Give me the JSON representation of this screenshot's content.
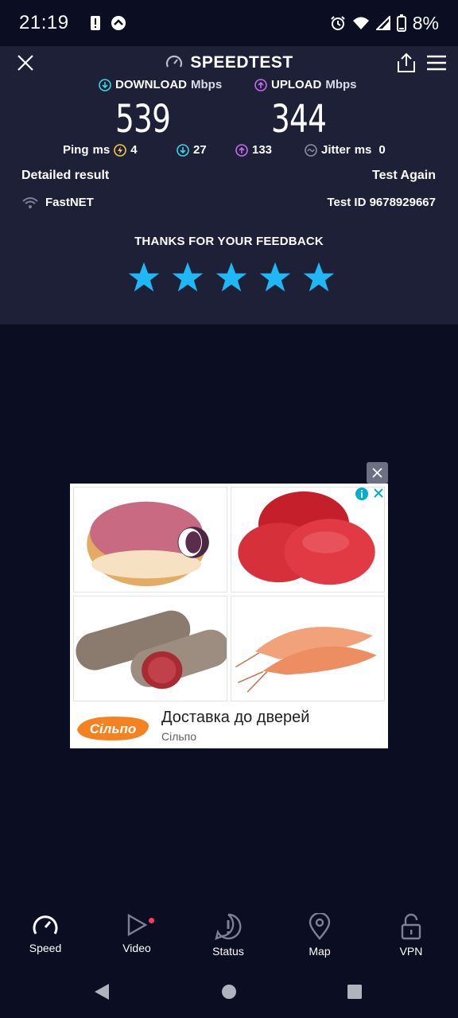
{
  "status_bar": {
    "time": "21:19",
    "battery": "8%"
  },
  "header": {
    "title": "SPEEDTEST"
  },
  "results": {
    "download_label": "DOWNLOAD",
    "upload_label": "UPLOAD",
    "unit": "Mbps",
    "download_value": "539",
    "upload_value": "344"
  },
  "latency": {
    "ping_label": "Ping",
    "ping_unit": "ms",
    "ping_value": "4",
    "ping_download": "27",
    "ping_upload": "133",
    "jitter_label": "Jitter",
    "jitter_unit": "ms",
    "jitter_value": "0"
  },
  "actions": {
    "detailed_result": "Detailed result",
    "test_again": "Test Again"
  },
  "server": {
    "provider": "FastNET",
    "test_id": "Test ID 9678929667"
  },
  "feedback": {
    "title": "THANKS FOR YOUR FEEDBACK",
    "rating": 5,
    "max_rating": 5
  },
  "ad": {
    "headline": "Доставка до дверей",
    "advertiser": "Сільпо",
    "brand_logo_text": "Сільпо"
  },
  "bottom_nav": {
    "items": [
      {
        "label": "Speed"
      },
      {
        "label": "Video"
      },
      {
        "label": "Status"
      },
      {
        "label": "Map"
      },
      {
        "label": "VPN"
      }
    ]
  },
  "colors": {
    "accent_blue": "#1fb8f5",
    "download_teal": "#3fd2e0",
    "upload_purple": "#c66bf0",
    "panel_bg": "#1e2038",
    "page_bg": "#0b0e22"
  }
}
